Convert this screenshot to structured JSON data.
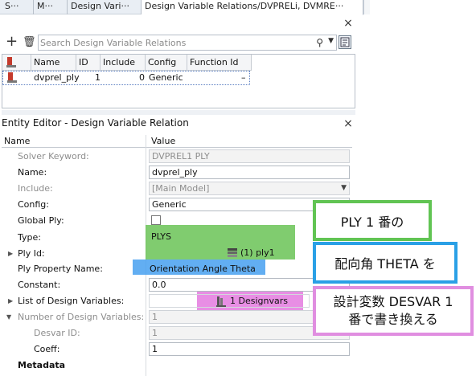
{
  "tabs": [
    {
      "label": "S···"
    },
    {
      "label": "M···"
    },
    {
      "label": "Design Vari···"
    },
    {
      "label": "Design Variable Relations/DVPRELi, DVMRE···"
    }
  ],
  "toolbar": {
    "search_placeholder": "Search Design Variable Relations",
    "add_symbol": "+",
    "delete_symbol": "🗑"
  },
  "grid": {
    "columns": [
      "Name",
      "ID",
      "Include",
      "Config",
      "Function Id"
    ],
    "rows": [
      {
        "name": "dvprel_ply",
        "id": "1",
        "include": "0",
        "config": "Generic",
        "function_id": "–"
      }
    ]
  },
  "editor": {
    "title": "Entity Editor - Design Variable Relation",
    "col_name": "Name",
    "col_value": "Value",
    "props": [
      {
        "label": "Solver Keyword:",
        "value": "DVPREL1 PLY"
      },
      {
        "label": "Name:",
        "value": "dvprel_ply"
      },
      {
        "label": "Include:",
        "value": "[Main Model]"
      },
      {
        "label": "Config:",
        "value": "Generic"
      },
      {
        "label": "Global Ply:",
        "value": ""
      },
      {
        "label": "Type:",
        "value": "PLYS"
      },
      {
        "label": "Ply Id:",
        "value": "(1) ply1"
      },
      {
        "label": "Ply Property Name:",
        "value": "Orientation Angle Theta"
      },
      {
        "label": "Constant:",
        "value": "0.0"
      },
      {
        "label": "List of Design Variables:",
        "value": "1 Designvars"
      },
      {
        "label": "Number of Design Variables:",
        "value": "1"
      },
      {
        "label": "Desvar ID:",
        "value": "1"
      },
      {
        "label": "Coeff:",
        "value": "1"
      },
      {
        "label": "Metadata",
        "value": ""
      }
    ]
  },
  "callouts": {
    "green": "PLY 1 番の",
    "blue": "配向角 THETA を",
    "pink_line1": "設計変数 DESVAR 1",
    "pink_line2": "番で書き換える"
  },
  "colors": {
    "green": "#61c453",
    "blue": "#2aa0e6",
    "pink": "#e08ee0"
  }
}
